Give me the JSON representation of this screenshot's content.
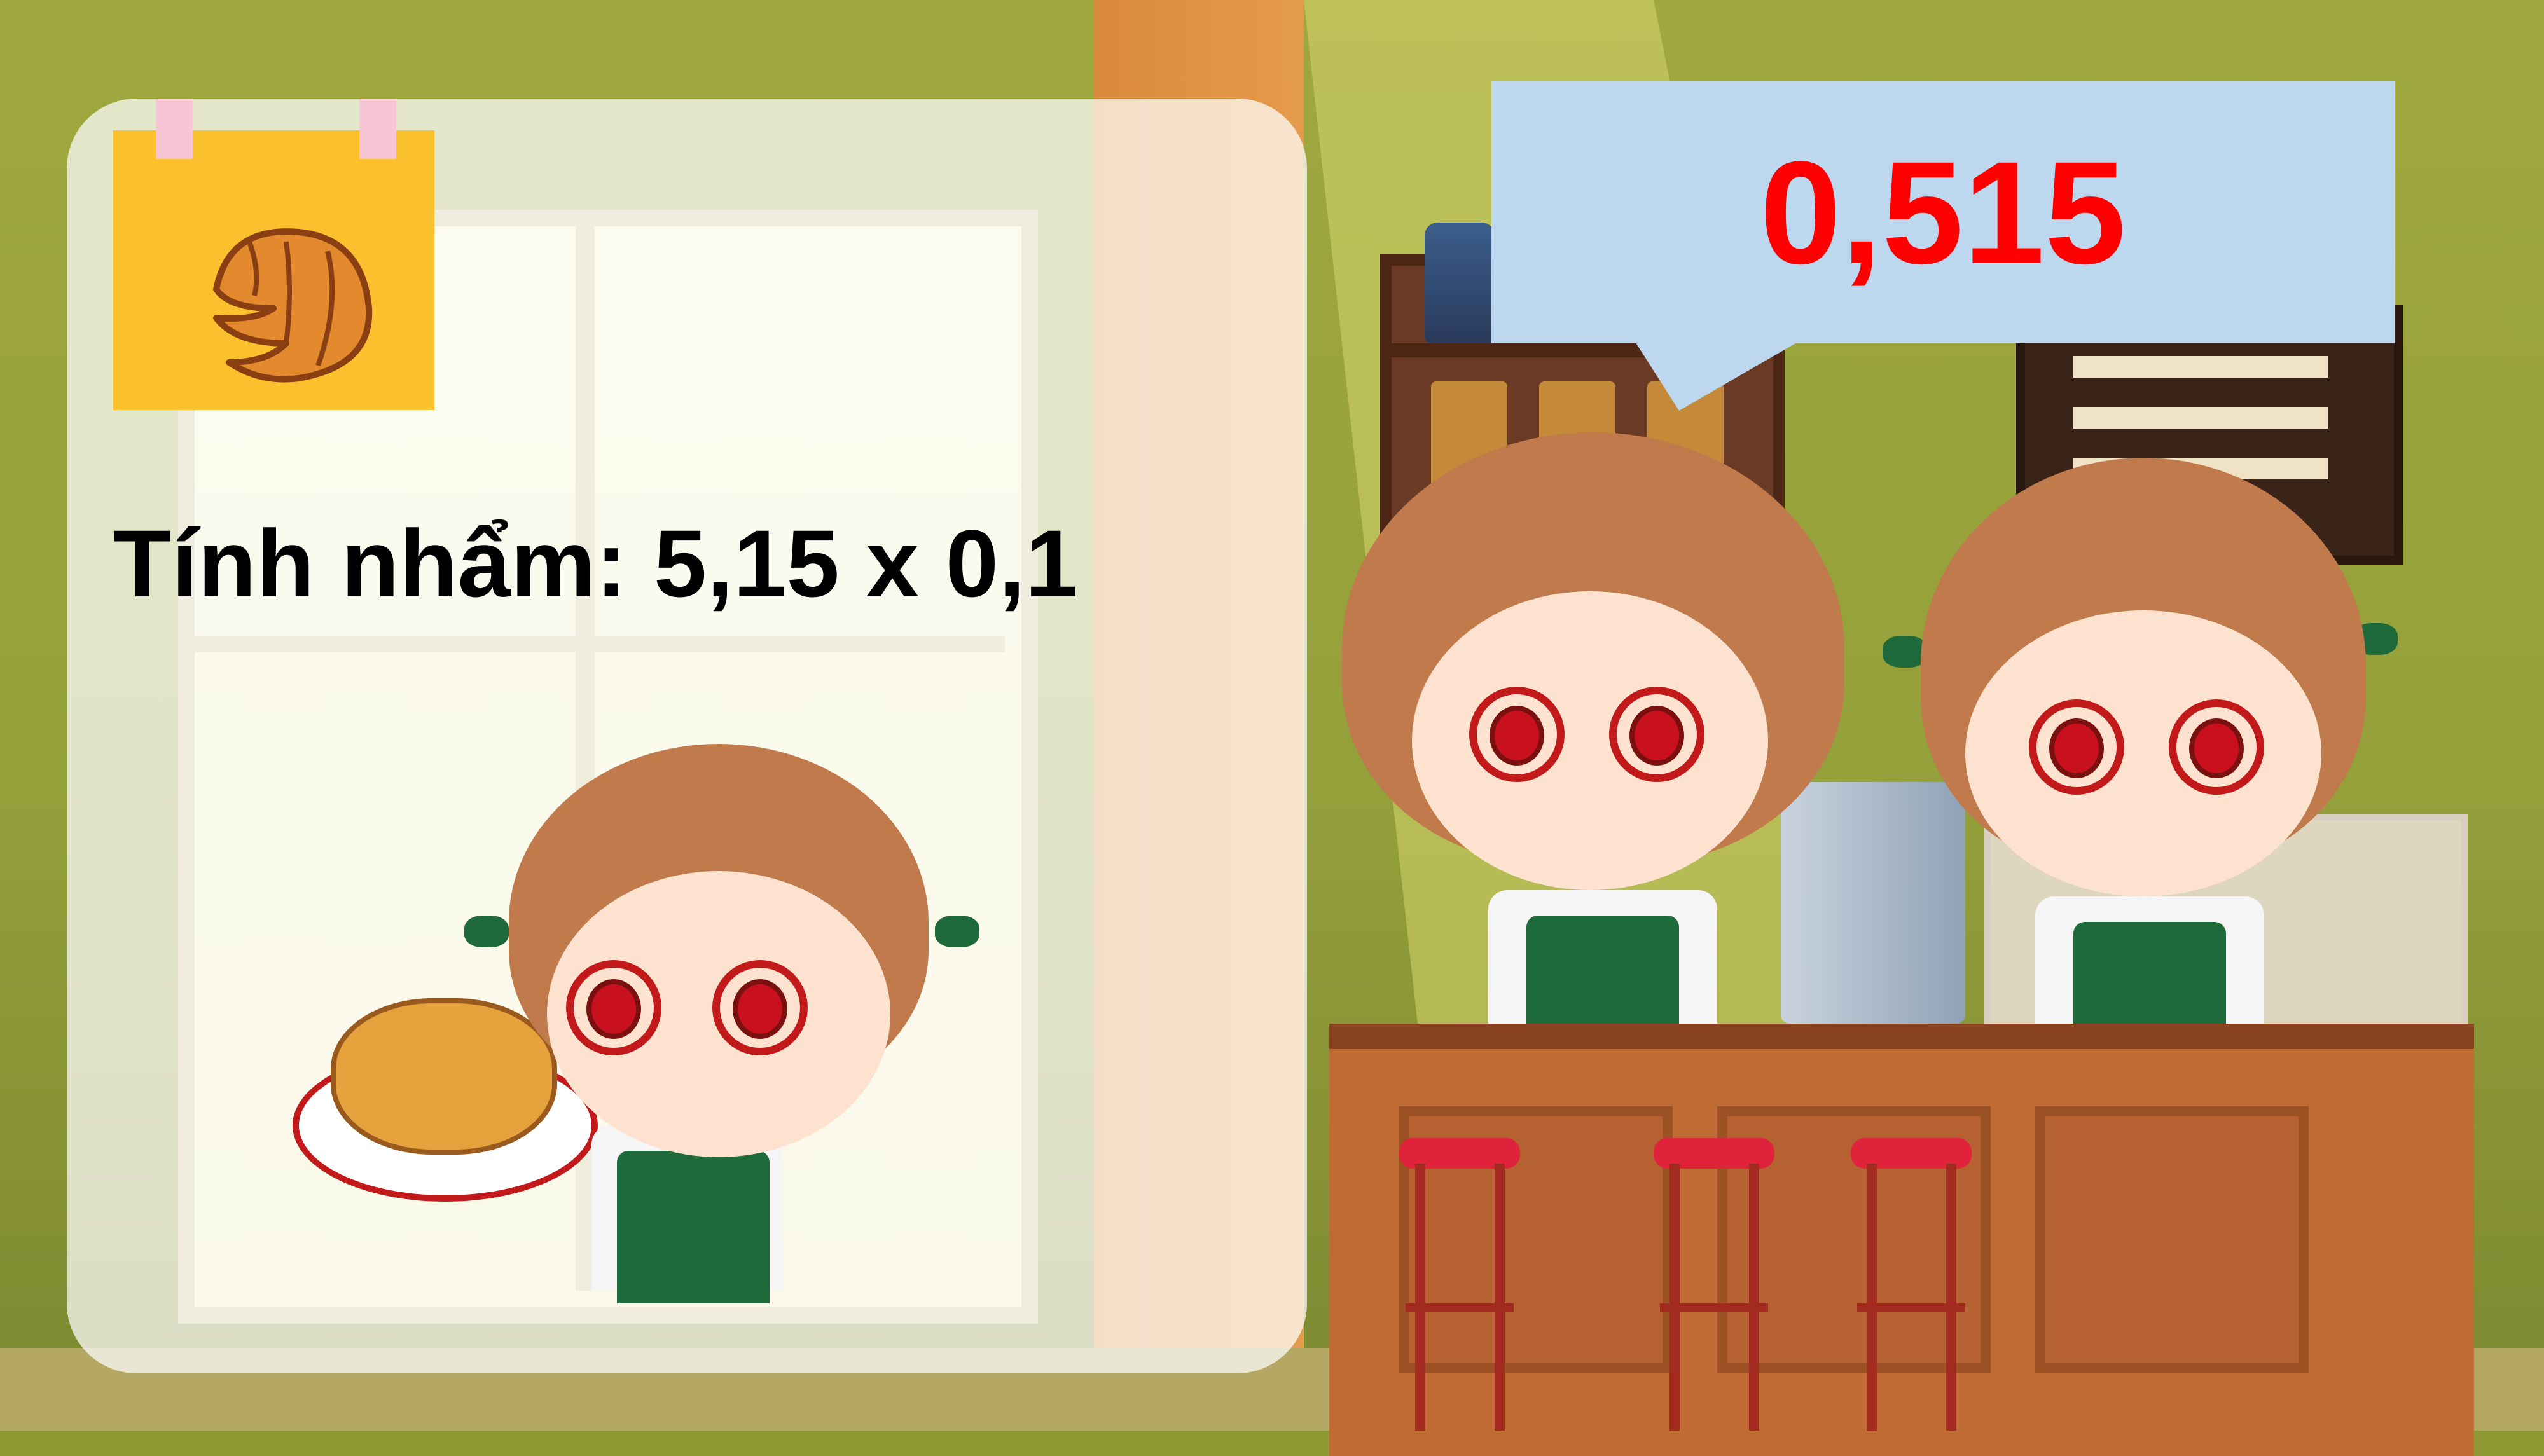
{
  "question": {
    "text": "Tính nhẩm: 5,15 x 0,1"
  },
  "answer": {
    "text": "0,515"
  },
  "colors": {
    "question_text": "#000000",
    "answer_text": "#ff0000",
    "bubble_background": "#bdd7ee",
    "sticky_note": "#fbc02d"
  },
  "icons": {
    "sticky_note_icon": "croissant-icon"
  }
}
